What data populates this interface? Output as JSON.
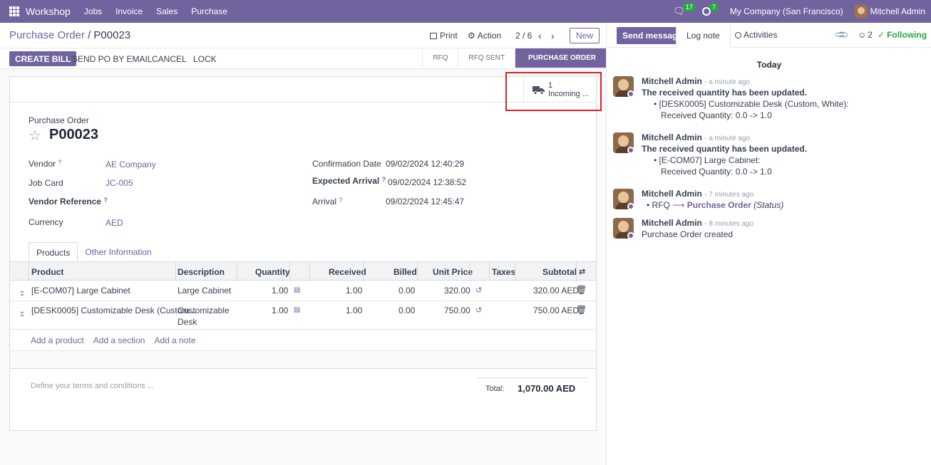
{
  "topbar": {
    "app": "Workshop",
    "nav": [
      "Jobs",
      "Invoice",
      "Sales",
      "Purchase"
    ],
    "chat_count": "17",
    "activity_count": "7",
    "company": "My Company (San Francisco)",
    "user": "Mitchell Admin"
  },
  "control": {
    "breadcrumb_parent": "Purchase Order",
    "breadcrumb_sep": "/",
    "breadcrumb_current": "P00023",
    "print": "Print",
    "action": "Action",
    "pager": "2 / 6",
    "new": "New"
  },
  "actions": {
    "create_bill": "CREATE BILL",
    "send_po": "SEND PO BY EMAIL",
    "cancel": "CANCEL",
    "lock": "LOCK"
  },
  "stages": [
    "RFQ",
    "RFQ SENT",
    "PURCHASE ORDER"
  ],
  "smart": {
    "count": "1",
    "label": "Incoming ..."
  },
  "form": {
    "doc_type": "Purchase Order",
    "name": "P00023",
    "vendor_label": "Vendor",
    "vendor": "AE Company",
    "jobcard_label": "Job Card",
    "jobcard": "JC-005",
    "vendor_ref_label": "Vendor Reference",
    "currency_label": "Currency",
    "currency": "AED",
    "conf_date_label": "Confirmation Date",
    "conf_date": "09/02/2024 12:40:29",
    "exp_arrival_label": "Expected Arrival",
    "exp_arrival": "09/02/2024 12:38:52",
    "arrival_label": "Arrival",
    "arrival": "09/02/2024 12:45:47"
  },
  "tabs": [
    "Products",
    "Other Information"
  ],
  "table": {
    "headers": [
      "Product",
      "Description",
      "Quantity",
      "Received",
      "Billed",
      "Unit Price",
      "Taxes",
      "Subtotal"
    ],
    "rows": [
      {
        "product": "[E-COM07] Large Cabinet",
        "description": "Large Cabinet",
        "description2": "",
        "quantity": "1.00",
        "received": "1.00",
        "billed": "0.00",
        "unit_price": "320.00",
        "subtotal": "320.00 AED"
      },
      {
        "product": "[DESK0005] Customizable Desk (Custom...",
        "description": "Customizable",
        "description2": "Desk",
        "quantity": "1.00",
        "received": "1.00",
        "billed": "0.00",
        "unit_price": "750.00",
        "subtotal": "750.00 AED"
      }
    ],
    "add_product": "Add a product",
    "add_section": "Add a section",
    "add_note": "Add a note"
  },
  "terms_placeholder": "Define your terms and conditions ...",
  "total": {
    "label": "Total:",
    "value": "1,070.00 AED"
  },
  "chatter": {
    "send_message": "Send message",
    "log_note": "Log note",
    "activities": "Activities",
    "followers": "2",
    "following": "Following",
    "today": "Today",
    "messages": [
      {
        "author": "Mitchell Admin",
        "time": "- a minute ago",
        "title": "The received quantity has been updated.",
        "line1": "[DESK0005] Customizable Desk (Custom, White):",
        "line2": "Received Quantity: 0.0 -> 1.0"
      },
      {
        "author": "Mitchell Admin",
        "time": "- a minute ago",
        "title": "The received quantity has been updated.",
        "line1": "[E-COM07] Large Cabinet:",
        "line2": "Received Quantity: 0.0 -> 1.0"
      },
      {
        "author": "Mitchell Admin",
        "time": "- 7 minutes ago",
        "from": "RFQ",
        "arrow": "⟶",
        "to": "Purchase Order",
        "field": "(Status)"
      },
      {
        "author": "Mitchell Admin",
        "time": "- 8 minutes ago",
        "text": "Purchase Order created"
      }
    ]
  }
}
